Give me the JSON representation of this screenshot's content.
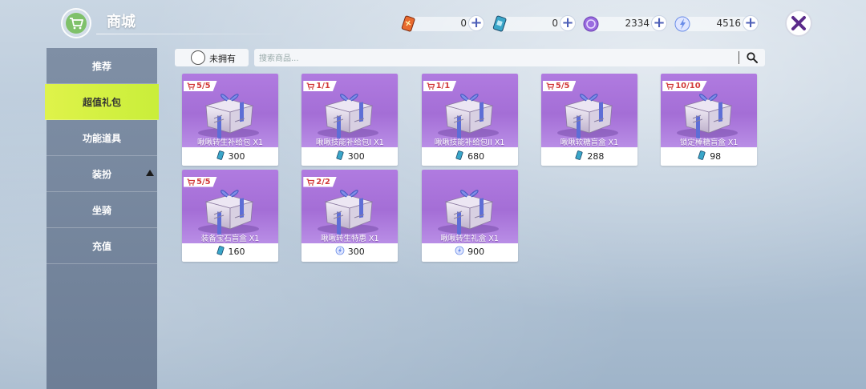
{
  "header": {
    "title": "商城",
    "close_icon": "close-x-icon",
    "currencies": [
      {
        "name": "red-card",
        "icon": "red-card-icon",
        "amount": "0",
        "color": "#e86a2e"
      },
      {
        "name": "blue-card",
        "icon": "blue-card-icon",
        "amount": "0",
        "color": "#3aa6c9"
      },
      {
        "name": "purple-orb",
        "icon": "purple-orb-icon",
        "amount": "2334",
        "color": "#9a6be0"
      },
      {
        "name": "blue-crystal",
        "icon": "crystal-icon",
        "amount": "4516",
        "color": "#6a8de8"
      }
    ]
  },
  "sidebar": {
    "items": [
      {
        "label": "推荐",
        "active": false
      },
      {
        "label": "超值礼包",
        "active": true
      },
      {
        "label": "功能道具",
        "active": false
      },
      {
        "label": "装扮",
        "active": false,
        "expandable": true
      },
      {
        "label": "坐骑",
        "active": false
      },
      {
        "label": "充值",
        "active": false
      }
    ]
  },
  "filter": {
    "own_label": "未拥有",
    "search_placeholder": "搜索商品..."
  },
  "products": [
    {
      "limit": "5/5",
      "name": "啾啾转生补给包 X1",
      "price": "300",
      "currency": "blue-card"
    },
    {
      "limit": "1/1",
      "name": "啾啾技能补给包I X1",
      "price": "300",
      "currency": "blue-card"
    },
    {
      "limit": "1/1",
      "name": "啾啾技能补给包II X1",
      "price": "680",
      "currency": "blue-card"
    },
    {
      "limit": "5/5",
      "name": "啾啾软糖盲盒 X1",
      "price": "288",
      "currency": "blue-card"
    },
    {
      "limit": "10/10",
      "name": "锁定棒糖盲盒 X1",
      "price": "98",
      "currency": "blue-card"
    },
    {
      "limit": "5/5",
      "name": "装备宝石盲盒 X1",
      "price": "160",
      "currency": "blue-card"
    },
    {
      "limit": "2/2",
      "name": "啾啾转生特惠 X1",
      "price": "300",
      "currency": "crystal"
    },
    {
      "limit": "",
      "name": "啾啾转生礼盒 X1",
      "price": "900",
      "currency": "crystal"
    }
  ]
}
